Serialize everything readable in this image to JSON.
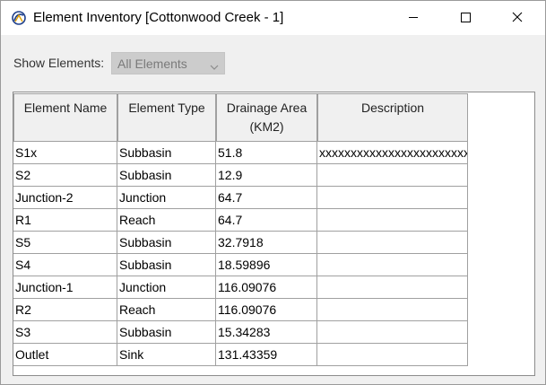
{
  "window": {
    "title": "Element Inventory [Cottonwood Creek - 1]",
    "icon": "hec-hms-app-icon",
    "controls": [
      "minimize-icon",
      "maximize-icon",
      "close-icon"
    ]
  },
  "filter": {
    "label": "Show Elements:",
    "selected": "All Elements"
  },
  "table": {
    "columns": [
      {
        "key": "name",
        "label": "Element Name"
      },
      {
        "key": "type",
        "label": "Element Type"
      },
      {
        "key": "area",
        "label": "Drainage Area (KM2)"
      },
      {
        "key": "desc",
        "label": "Description"
      }
    ],
    "rows": [
      {
        "name": "S1x",
        "type": "Subbasin",
        "area": "51.8",
        "desc": "xxxxxxxxxxxxxxxxxxxxxxxxxxxx"
      },
      {
        "name": "S2",
        "type": "Subbasin",
        "area": "12.9",
        "desc": ""
      },
      {
        "name": "Junction-2",
        "type": "Junction",
        "area": "64.7",
        "desc": ""
      },
      {
        "name": "R1",
        "type": "Reach",
        "area": "64.7",
        "desc": ""
      },
      {
        "name": "S5",
        "type": "Subbasin",
        "area": "32.7918",
        "desc": ""
      },
      {
        "name": "S4",
        "type": "Subbasin",
        "area": "18.59896",
        "desc": ""
      },
      {
        "name": "Junction-1",
        "type": "Junction",
        "area": "116.09076",
        "desc": ""
      },
      {
        "name": "R2",
        "type": "Reach",
        "area": "116.09076",
        "desc": ""
      },
      {
        "name": "S3",
        "type": "Subbasin",
        "area": "15.34283",
        "desc": ""
      },
      {
        "name": "Outlet",
        "type": "Sink",
        "area": "131.43359",
        "desc": ""
      }
    ]
  }
}
